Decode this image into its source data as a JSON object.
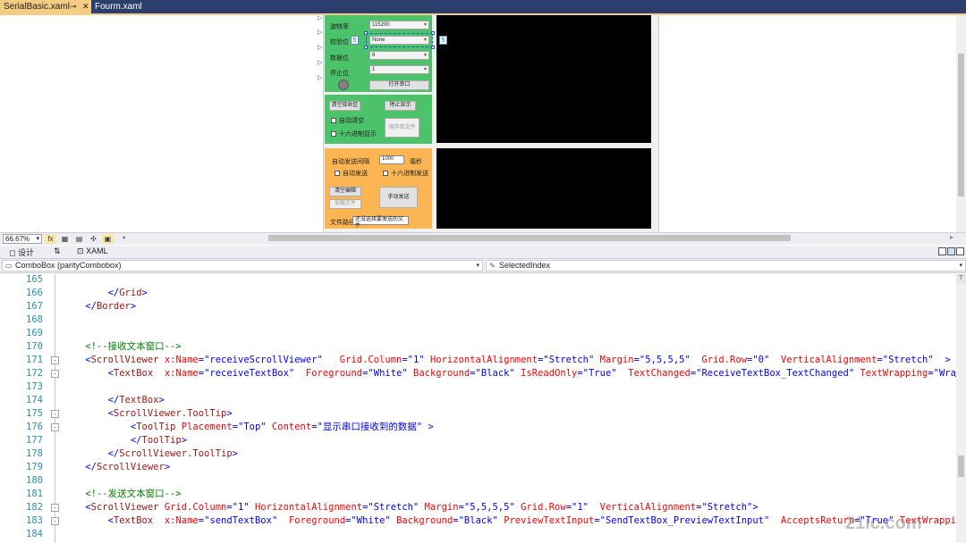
{
  "tabs": [
    {
      "label": "SerialBasic.xaml",
      "pin": "⊸",
      "close": "✕"
    },
    {
      "label": "Fourm.xaml"
    }
  ],
  "designer": {
    "labels": {
      "baud": "波特率",
      "parity": "校验位",
      "databits": "数据位",
      "stopbits": "停止位"
    },
    "combos": {
      "baud": "115200",
      "parity": "None",
      "databits": "8",
      "stopbits": "1"
    },
    "open_port": "打开串口",
    "clear_recv": "清空接收区",
    "stop_display": "停止显示",
    "auto_clear": "自动清空",
    "hex_display": "十六进制显示",
    "save_file": "保存到文件",
    "auto_send_interval": "自动发送间隔",
    "interval_value": "1000",
    "ms": "毫秒",
    "auto_send": "自动发送",
    "hex_send": "十六进制发送",
    "clear_edit": "清空编辑",
    "load_file": "加载文件",
    "manual_send": "手动发送",
    "file_path": "文件路径",
    "file_path_value": "还没选择要发送的文件",
    "sel_tag_left": "5",
    "sel_tag_right": "5"
  },
  "zoom": "66.67%",
  "split_tabs": {
    "design": "设计",
    "swap": "⇅",
    "xaml": "XAML"
  },
  "nav": {
    "element": "ComboBox (parityCombobox)",
    "property": "SelectedIndex"
  },
  "code_lines": [
    {
      "n": "165",
      "fold": "",
      "html": ""
    },
    {
      "n": "166",
      "fold": "",
      "html": "        <span class='cb'>&lt;/</span><span class='cn'>Grid</span><span class='cb'>&gt;</span>"
    },
    {
      "n": "167",
      "fold": "",
      "html": "    <span class='cb'>&lt;/</span><span class='cn'>Border</span><span class='cb'>&gt;</span>"
    },
    {
      "n": "168",
      "fold": "",
      "html": ""
    },
    {
      "n": "169",
      "fold": "",
      "html": ""
    },
    {
      "n": "170",
      "fold": "",
      "html": "    <span class='cc'>&lt;!--接收文本窗口--&gt;</span>"
    },
    {
      "n": "171",
      "fold": "-",
      "html": "    <span class='cb'>&lt;</span><span class='cn'>ScrollViewer</span> <span class='ca'>x:Name</span><span class='cb'>=\"receiveScrollViewer\"</span>   <span class='ca'>Grid.Column</span><span class='cb'>=\"1\"</span> <span class='ca'>HorizontalAlignment</span><span class='cb'>=\"Stretch\"</span> <span class='ca'>Margin</span><span class='cb'>=\"5,5,5,5\"</span>  <span class='ca'>Grid.Row</span><span class='cb'>=\"0\"</span>  <span class='ca'>VerticalAlignment</span><span class='cb'>=\"Stretch\"</span>  <span class='cb'>&gt;</span>"
    },
    {
      "n": "172",
      "fold": "-",
      "html": "        <span class='cb'>&lt;</span><span class='cn'>TextBox</span>  <span class='ca'>x:Name</span><span class='cb'>=\"receiveTextBox\"</span>  <span class='ca'>Foreground</span><span class='cb'>=\"White\"</span> <span class='ca'>Background</span><span class='cb'>=\"Black\"</span> <span class='ca'>IsReadOnly</span><span class='cb'>=\"True\"</span>  <span class='ca'>TextChanged</span><span class='cb'>=\"ReceiveTextBox_TextChanged\"</span> <span class='ca'>TextWrapping</span><span class='cb'>=\"Wrap\"</span>"
    },
    {
      "n": "173",
      "fold": "",
      "html": ""
    },
    {
      "n": "174",
      "fold": "",
      "html": "        <span class='cb'>&lt;/</span><span class='cn'>TextBox</span><span class='cb'>&gt;</span>"
    },
    {
      "n": "175",
      "fold": "-",
      "html": "        <span class='cb'>&lt;</span><span class='cn'>ScrollViewer.ToolTip</span><span class='cb'>&gt;</span>"
    },
    {
      "n": "176",
      "fold": "-",
      "html": "            <span class='cb'>&lt;</span><span class='cn'>ToolTip</span> <span class='ca'>Placement</span><span class='cb'>=\"Top\"</span> <span class='ca'>Content</span><span class='cb'>=\"显示串口接收到的数据\"</span> <span class='cb'>&gt;</span>"
    },
    {
      "n": "177",
      "fold": "",
      "html": "            <span class='cb'>&lt;/</span><span class='cn'>ToolTip</span><span class='cb'>&gt;</span>"
    },
    {
      "n": "178",
      "fold": "",
      "html": "        <span class='cb'>&lt;/</span><span class='cn'>ScrollViewer.ToolTip</span><span class='cb'>&gt;</span>"
    },
    {
      "n": "179",
      "fold": "",
      "html": "    <span class='cb'>&lt;/</span><span class='cn'>ScrollViewer</span><span class='cb'>&gt;</span>"
    },
    {
      "n": "180",
      "fold": "",
      "html": ""
    },
    {
      "n": "181",
      "fold": "",
      "html": "    <span class='cc'>&lt;!--发送文本窗口--&gt;</span>"
    },
    {
      "n": "182",
      "fold": "-",
      "html": "    <span class='cb'>&lt;</span><span class='cn'>ScrollViewer</span> <span class='ca'>Grid.Column</span><span class='cb'>=\"1\"</span> <span class='ca'>HorizontalAlignment</span><span class='cb'>=\"Stretch\"</span> <span class='ca'>Margin</span><span class='cb'>=\"5,5,5,5\"</span> <span class='ca'>Grid.Row</span><span class='cb'>=\"1\"</span>  <span class='ca'>VerticalAlignment</span><span class='cb'>=\"Stretch\"</span><span class='cb'>&gt;</span>"
    },
    {
      "n": "183",
      "fold": "-",
      "html": "        <span class='cb'>&lt;</span><span class='cn'>TextBox</span>  <span class='ca'>x:Name</span><span class='cb'>=\"sendTextBox\"</span>  <span class='ca'>Foreground</span><span class='cb'>=\"White\"</span> <span class='ca'>Background</span><span class='cb'>=\"Black\"</span> <span class='ca'>PreviewTextInput</span><span class='cb'>=\"SendTextBox_PreviewTextInput\"</span>  <span class='ca'>AcceptsReturn</span><span class='cb'>=\"True\"</span> <span class='ca'>TextWrapping</span>"
    },
    {
      "n": "184",
      "fold": "",
      "html": ""
    }
  ],
  "watermark": "21ic.com",
  "colors": {
    "tab_active": "#f5cc84",
    "tab_strip": "#2b3e6e",
    "green_panel": "#4cc36a",
    "orange_panel": "#fbb553"
  }
}
